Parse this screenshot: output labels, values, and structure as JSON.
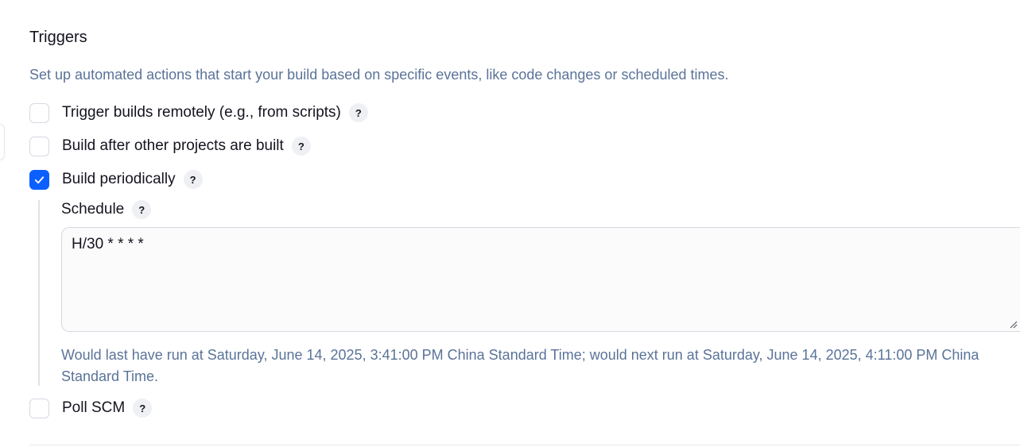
{
  "section": {
    "title": "Triggers",
    "description": "Set up automated actions that start your build based on specific events, like code changes or scheduled times."
  },
  "options": [
    {
      "label": "Trigger builds remotely (e.g., from scripts)",
      "checked": false
    },
    {
      "label": "Build after other projects are built",
      "checked": false
    },
    {
      "label": "Build periodically",
      "checked": true
    },
    {
      "label": "Poll SCM",
      "checked": false
    }
  ],
  "help_glyph": "?",
  "schedule": {
    "label": "Schedule",
    "value": "H/30 * * * *",
    "info": "Would last have run at Saturday, June 14, 2025, 3:41:00 PM China Standard Time; would next run at Saturday, June 14, 2025, 4:11:00 PM China Standard Time."
  },
  "colors": {
    "accent": "#0b5fff",
    "muted_text": "#5a7398"
  }
}
